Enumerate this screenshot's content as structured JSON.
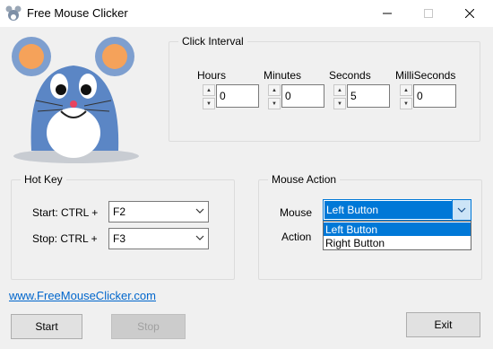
{
  "window": {
    "title": "Free Mouse Clicker",
    "icon": "mouse-app-icon"
  },
  "click_interval": {
    "title": "Click Interval",
    "fields": [
      {
        "label": "Hours",
        "value": "0"
      },
      {
        "label": "Minutes",
        "value": "0"
      },
      {
        "label": "Seconds",
        "value": "5"
      },
      {
        "label": "MilliSeconds",
        "value": "0"
      }
    ]
  },
  "hot_key": {
    "title": "Hot Key",
    "start_label": "Start: CTRL +",
    "start_value": "F2",
    "stop_label": "Stop: CTRL +",
    "stop_value": "F3"
  },
  "mouse_action": {
    "title": "Mouse Action",
    "mouse_label": "Mouse",
    "mouse_value": "Left Button",
    "action_label": "Action",
    "dropdown_options": [
      "Left Button",
      "Right Button"
    ]
  },
  "link": "www.FreeMouseClicker.com",
  "buttons": {
    "start": "Start",
    "stop": "Stop",
    "exit": "Exit"
  },
  "colors": {
    "accent": "#0078d7",
    "link": "#0066cc",
    "mascot_body": "#5b86c5"
  }
}
